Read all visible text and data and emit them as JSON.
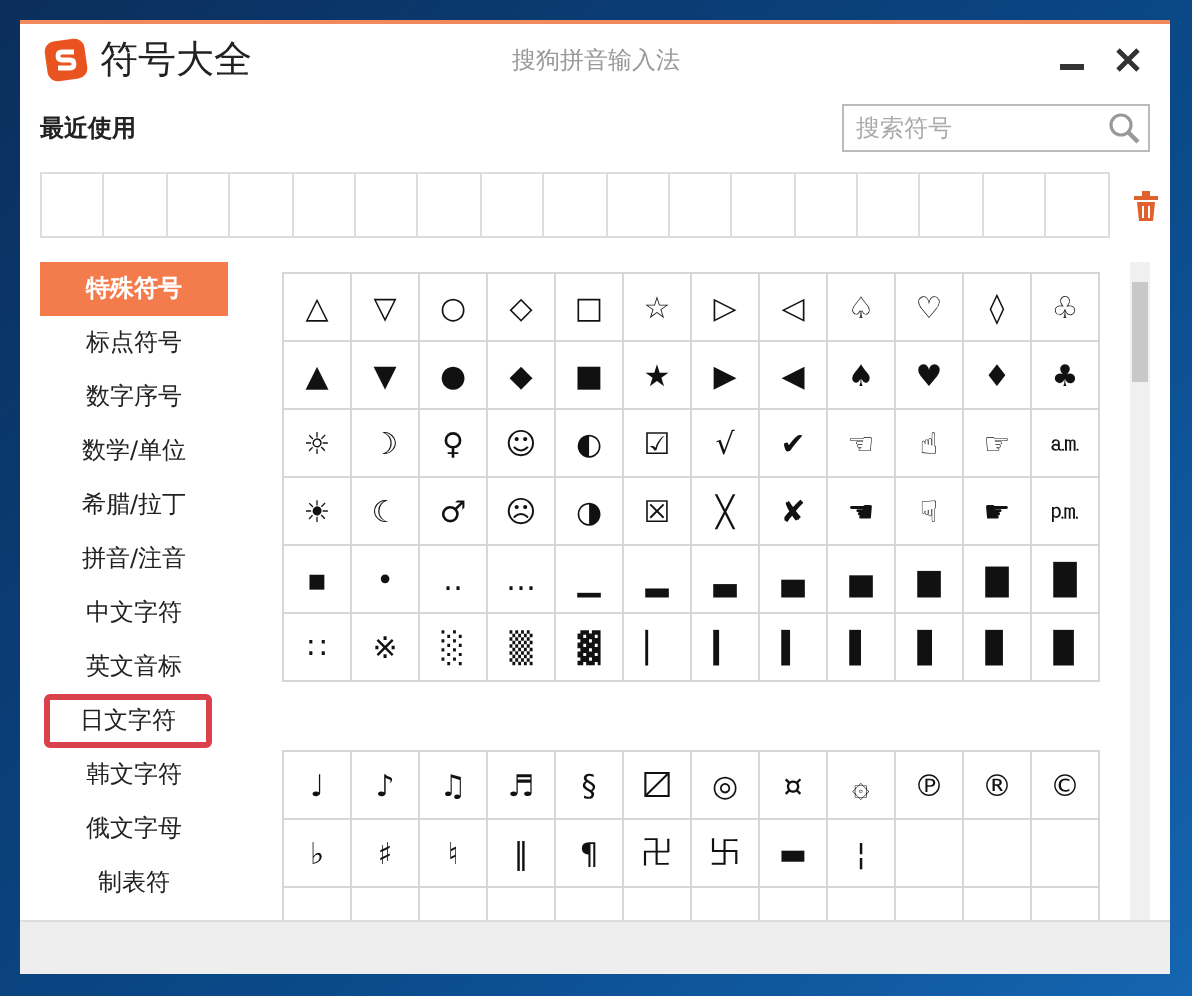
{
  "window": {
    "title": "符号大全",
    "subtitle": "搜狗拼音输入法"
  },
  "recent": {
    "label": "最近使用"
  },
  "search": {
    "placeholder": "搜索符号"
  },
  "categories": [
    {
      "label": "特殊符号",
      "selected": true,
      "outlined": false
    },
    {
      "label": "标点符号",
      "selected": false,
      "outlined": false
    },
    {
      "label": "数字序号",
      "selected": false,
      "outlined": false
    },
    {
      "label": "数学/单位",
      "selected": false,
      "outlined": false
    },
    {
      "label": "希腊/拉丁",
      "selected": false,
      "outlined": false
    },
    {
      "label": "拼音/注音",
      "selected": false,
      "outlined": false
    },
    {
      "label": "中文字符",
      "selected": false,
      "outlined": false
    },
    {
      "label": "英文音标",
      "selected": false,
      "outlined": false
    },
    {
      "label": "日文字符",
      "selected": false,
      "outlined": true
    },
    {
      "label": "韩文字符",
      "selected": false,
      "outlined": false
    },
    {
      "label": "俄文字母",
      "selected": false,
      "outlined": false
    },
    {
      "label": "制表符",
      "selected": false,
      "outlined": false
    }
  ],
  "symbol_groups": [
    {
      "rows": [
        [
          "△",
          "▽",
          "○",
          "◇",
          "□",
          "☆",
          "▷",
          "◁",
          "♤",
          "♡",
          "◊",
          "♧"
        ],
        [
          "▲",
          "▼",
          "●",
          "◆",
          "■",
          "★",
          "▶",
          "◀",
          "♠",
          "♥",
          "♦",
          "♣"
        ],
        [
          "☼",
          "☽",
          "♀",
          "☺",
          "◐",
          "☑",
          "√",
          "✔",
          "☜",
          "☝",
          "☞",
          "㏂"
        ],
        [
          "☀",
          "☾",
          "♂",
          "☹",
          "◑",
          "☒",
          "╳",
          "✘",
          "☚",
          "☟",
          "☛",
          "㏘"
        ],
        [
          "▪",
          "•",
          "‥",
          "…",
          "▁",
          "▂",
          "▃",
          "▄",
          "▅",
          "▆",
          "▇",
          "█"
        ],
        [
          "∷",
          "※",
          "░",
          "▒",
          "▓",
          "▏",
          "▎",
          "▍",
          "▌",
          "▋",
          "▊",
          "▉"
        ]
      ]
    },
    {
      "rows": [
        [
          "♩",
          "♪",
          "♫",
          "♬",
          "§",
          "〼",
          "◎",
          "¤",
          "۞",
          "℗",
          "®",
          "©"
        ],
        [
          "♭",
          "♯",
          "♮",
          "‖",
          "¶",
          "卍",
          "卐",
          "▬",
          "¦"
        ]
      ]
    }
  ]
}
